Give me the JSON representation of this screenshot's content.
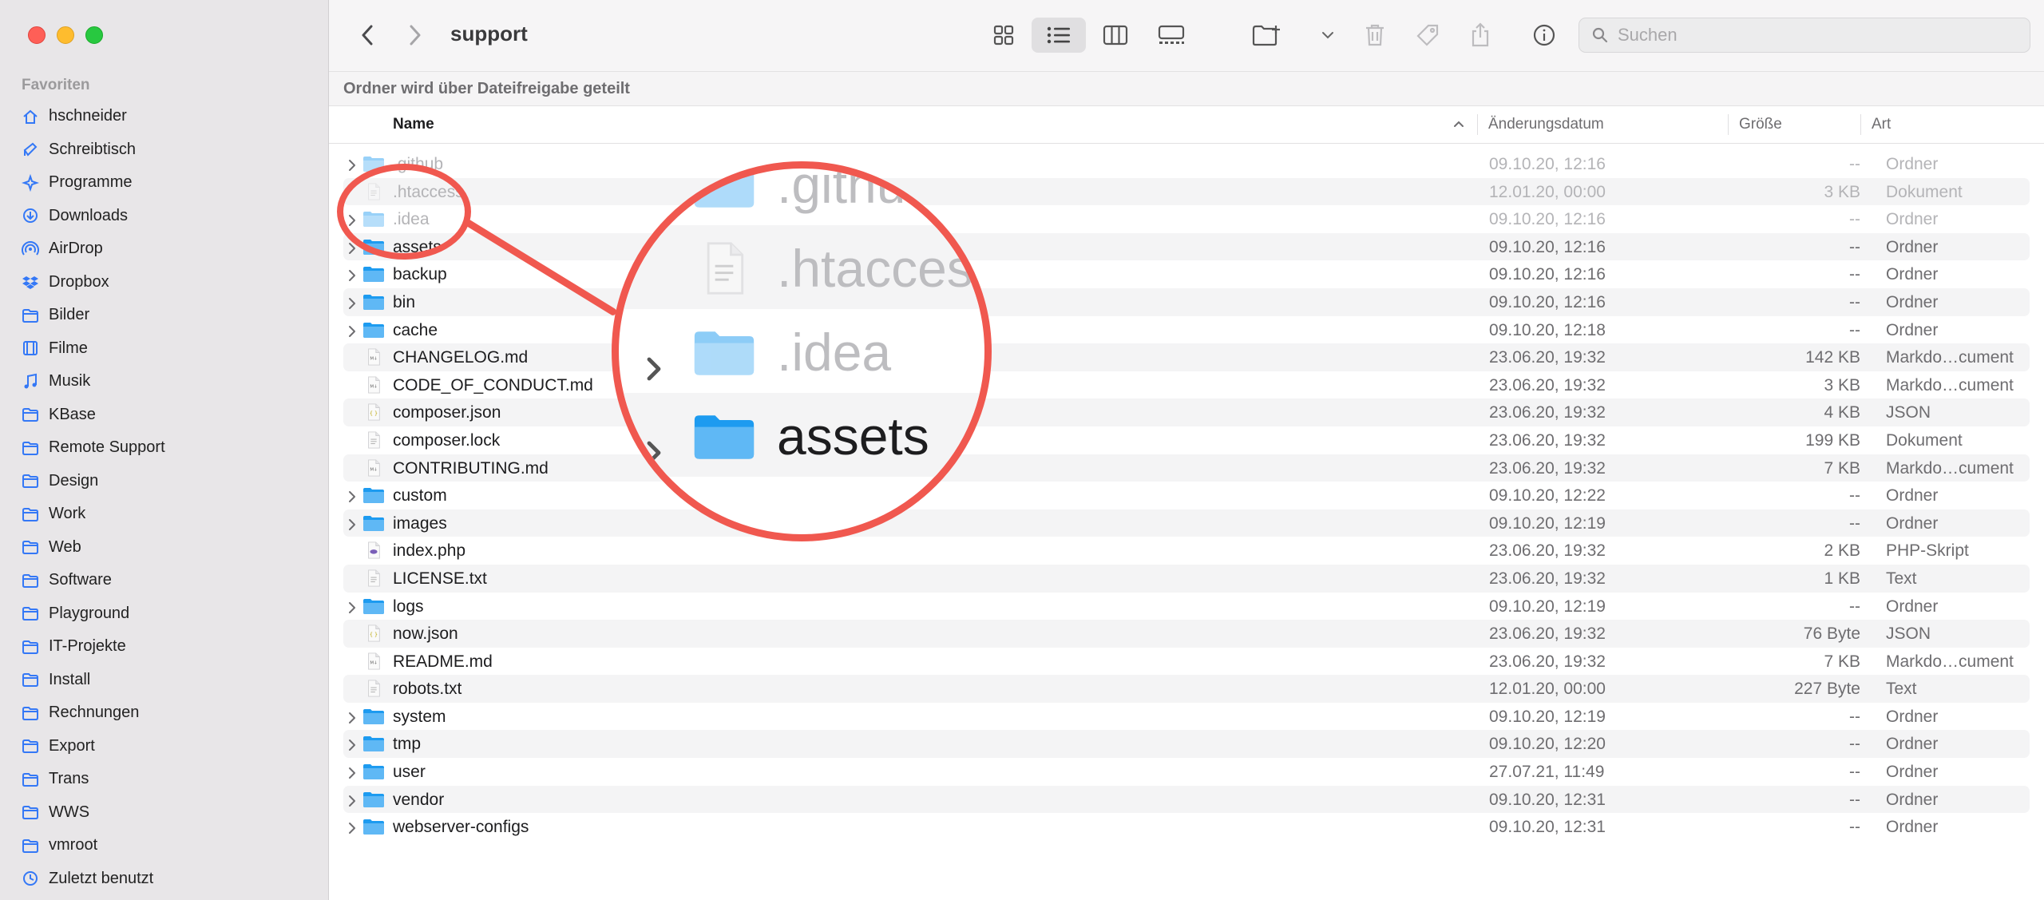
{
  "window": {
    "title": "support",
    "share_banner": "Ordner wird über Dateifreigabe geteilt"
  },
  "search": {
    "placeholder": "Suchen",
    "value": ""
  },
  "sidebar": {
    "section": "Favoriten",
    "items": [
      {
        "label": "hschneider",
        "icon": "home-icon"
      },
      {
        "label": "Schreibtisch",
        "icon": "desktop-icon"
      },
      {
        "label": "Programme",
        "icon": "applications-icon"
      },
      {
        "label": "Downloads",
        "icon": "downloads-icon"
      },
      {
        "label": "AirDrop",
        "icon": "airdrop-icon"
      },
      {
        "label": "Dropbox",
        "icon": "dropbox-icon"
      },
      {
        "label": "Bilder",
        "icon": "folder-icon"
      },
      {
        "label": "Filme",
        "icon": "film-icon"
      },
      {
        "label": "Musik",
        "icon": "music-icon"
      },
      {
        "label": "KBase",
        "icon": "folder-icon"
      },
      {
        "label": "Remote Support",
        "icon": "folder-icon"
      },
      {
        "label": "Design",
        "icon": "folder-icon"
      },
      {
        "label": "Work",
        "icon": "folder-icon"
      },
      {
        "label": "Web",
        "icon": "folder-icon"
      },
      {
        "label": "Software",
        "icon": "folder-icon"
      },
      {
        "label": "Playground",
        "icon": "folder-icon"
      },
      {
        "label": "IT-Projekte",
        "icon": "folder-icon"
      },
      {
        "label": "Install",
        "icon": "folder-icon"
      },
      {
        "label": "Rechnungen",
        "icon": "folder-icon"
      },
      {
        "label": "Export",
        "icon": "folder-icon"
      },
      {
        "label": "Trans",
        "icon": "folder-icon"
      },
      {
        "label": "WWS",
        "icon": "folder-icon"
      },
      {
        "label": "vmroot",
        "icon": "folder-icon"
      },
      {
        "label": "Zuletzt benutzt",
        "icon": "clock-icon"
      }
    ]
  },
  "columns": {
    "name": "Name",
    "date": "Änderungsdatum",
    "size": "Größe",
    "kind": "Art"
  },
  "files": [
    {
      "name": ".github",
      "date": "09.10.20, 12:16",
      "size": "--",
      "kind": "Ordner",
      "type": "folder",
      "hidden": true
    },
    {
      "name": ".htaccess",
      "date": "12.01.20, 00:00",
      "size": "3 KB",
      "kind": "Dokument",
      "type": "doc",
      "hidden": true
    },
    {
      "name": ".idea",
      "date": "09.10.20, 12:16",
      "size": "--",
      "kind": "Ordner",
      "type": "folder",
      "hidden": true
    },
    {
      "name": "assets",
      "date": "09.10.20, 12:16",
      "size": "--",
      "kind": "Ordner",
      "type": "folder"
    },
    {
      "name": "backup",
      "date": "09.10.20, 12:16",
      "size": "--",
      "kind": "Ordner",
      "type": "folder"
    },
    {
      "name": "bin",
      "date": "09.10.20, 12:16",
      "size": "--",
      "kind": "Ordner",
      "type": "folder"
    },
    {
      "name": "cache",
      "date": "09.10.20, 12:18",
      "size": "--",
      "kind": "Ordner",
      "type": "folder"
    },
    {
      "name": "CHANGELOG.md",
      "date": "23.06.20, 19:32",
      "size": "142 KB",
      "kind": "Markdo…cument",
      "type": "md"
    },
    {
      "name": "CODE_OF_CONDUCT.md",
      "date": "23.06.20, 19:32",
      "size": "3 KB",
      "kind": "Markdo…cument",
      "type": "md"
    },
    {
      "name": "composer.json",
      "date": "23.06.20, 19:32",
      "size": "4 KB",
      "kind": "JSON",
      "type": "json"
    },
    {
      "name": "composer.lock",
      "date": "23.06.20, 19:32",
      "size": "199 KB",
      "kind": "Dokument",
      "type": "doc"
    },
    {
      "name": "CONTRIBUTING.md",
      "date": "23.06.20, 19:32",
      "size": "7 KB",
      "kind": "Markdo…cument",
      "type": "md"
    },
    {
      "name": "custom",
      "date": "09.10.20, 12:22",
      "size": "--",
      "kind": "Ordner",
      "type": "folder"
    },
    {
      "name": "images",
      "date": "09.10.20, 12:19",
      "size": "--",
      "kind": "Ordner",
      "type": "folder"
    },
    {
      "name": "index.php",
      "date": "23.06.20, 19:32",
      "size": "2 KB",
      "kind": "PHP-Skript",
      "type": "php"
    },
    {
      "name": "LICENSE.txt",
      "date": "23.06.20, 19:32",
      "size": "1 KB",
      "kind": "Text",
      "type": "txt"
    },
    {
      "name": "logs",
      "date": "09.10.20, 12:19",
      "size": "--",
      "kind": "Ordner",
      "type": "folder"
    },
    {
      "name": "now.json",
      "date": "23.06.20, 19:32",
      "size": "76 Byte",
      "kind": "JSON",
      "type": "json"
    },
    {
      "name": "README.md",
      "date": "23.06.20, 19:32",
      "size": "7 KB",
      "kind": "Markdo…cument",
      "type": "md"
    },
    {
      "name": "robots.txt",
      "date": "12.01.20, 00:00",
      "size": "227 Byte",
      "kind": "Text",
      "type": "txt"
    },
    {
      "name": "system",
      "date": "09.10.20, 12:19",
      "size": "--",
      "kind": "Ordner",
      "type": "folder"
    },
    {
      "name": "tmp",
      "date": "09.10.20, 12:20",
      "size": "--",
      "kind": "Ordner",
      "type": "folder"
    },
    {
      "name": "user",
      "date": "27.07.21, 11:49",
      "size": "--",
      "kind": "Ordner",
      "type": "folder"
    },
    {
      "name": "vendor",
      "date": "09.10.20, 12:31",
      "size": "--",
      "kind": "Ordner",
      "type": "folder"
    },
    {
      "name": "webserver-configs",
      "date": "09.10.20, 12:31",
      "size": "--",
      "kind": "Ordner",
      "type": "folder"
    }
  ],
  "zoom": {
    "items": [
      ".github",
      ".htaccess",
      ".idea",
      "assets"
    ]
  }
}
